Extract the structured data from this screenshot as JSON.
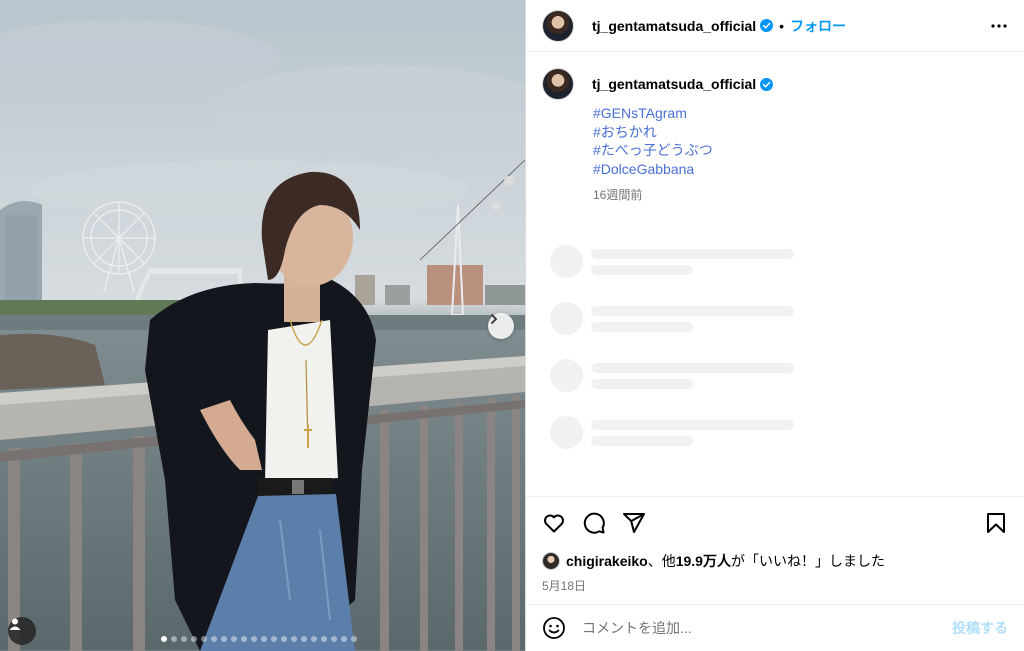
{
  "post": {
    "username": "tj_gentamatsuda_official",
    "separator": "•",
    "follow_label": "フォロー",
    "hashtags": [
      "#GENsTAgram",
      "#おちかれ",
      "#たべっ子どうぶつ",
      "#DolceGabbana"
    ],
    "time_ago": "16週間前",
    "likes": {
      "first_user": "chigirakeiko",
      "mid": "、他",
      "count": "19.9万人",
      "suffix": "が「いいね！」しました"
    },
    "date": "5月18日",
    "carousel": {
      "total_slides": 20,
      "active_index": 0
    }
  },
  "comment_box": {
    "placeholder": "コメントを追加...",
    "post_label": "投稿する"
  },
  "colors": {
    "accent": "#0095f6",
    "hashtag": "#4a6fd6",
    "muted": "#737373"
  },
  "icons": [
    "verified-badge-icon",
    "more-options-icon",
    "heart-icon",
    "comment-icon",
    "share-icon",
    "bookmark-icon",
    "emoji-icon",
    "user-tag-icon",
    "chevron-right-icon"
  ]
}
